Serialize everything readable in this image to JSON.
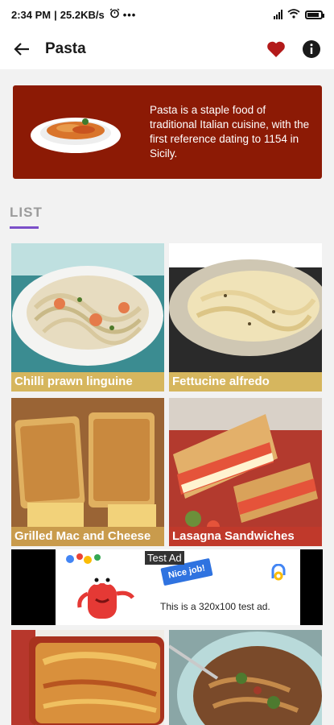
{
  "status": {
    "time": "2:34 PM",
    "speed": "25.2KB/s"
  },
  "appbar": {
    "title": "Pasta",
    "icons": [
      "back-arrow-icon",
      "heart-icon",
      "info-icon"
    ]
  },
  "hero": {
    "description": "Pasta is a staple food of traditional Italian cuisine, with the first reference dating to 1154 in Sicily."
  },
  "section": {
    "label": "LIST"
  },
  "items": [
    {
      "label": "Chilli prawn linguine",
      "label_color": "#d6b65e"
    },
    {
      "label": "Fettucine alfredo",
      "label_color": "#d6b65e"
    },
    {
      "label": "Grilled Mac and Cheese",
      "label_color": "#c99b4c"
    },
    {
      "label": "Lasagna Sandwiches",
      "label_color": "#c0392b"
    }
  ],
  "ad": {
    "tag": "Test Ad",
    "badge": "Nice job!",
    "text": "This is a 320x100 test ad."
  },
  "colors": {
    "hero_bg": "#8c1a05",
    "heart": "#b31a1a",
    "accent": "#7b4fc8"
  }
}
